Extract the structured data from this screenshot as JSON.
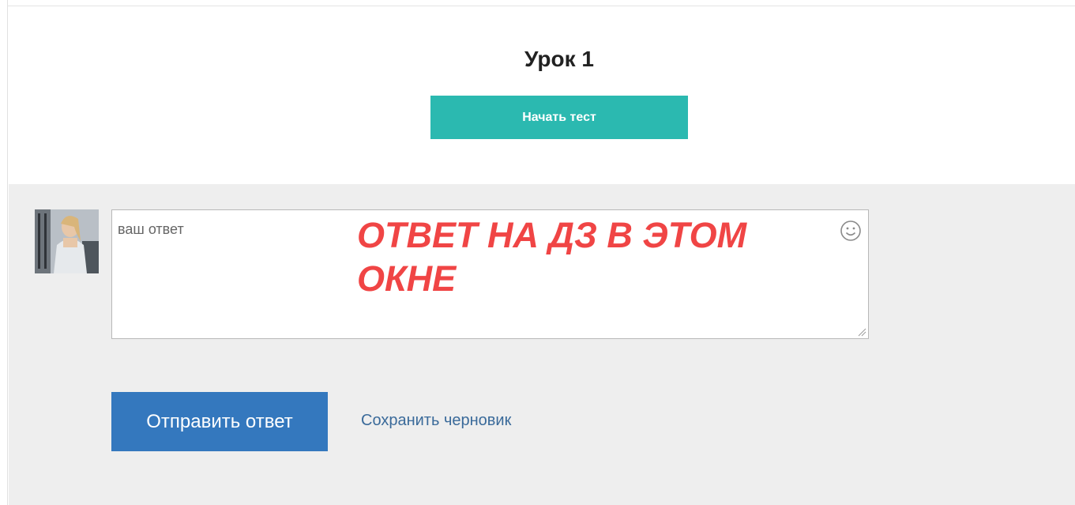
{
  "lesson": {
    "title": "Урок 1",
    "start_button_label": "Начать тест"
  },
  "comment": {
    "avatar_icon": "user-photo",
    "placeholder": "ваш ответ",
    "value": "",
    "annotation": "ОТВЕТ НА ДЗ В ЭТОМ ОКНЕ",
    "emoji_icon": "smiley-icon",
    "submit_label": "Отправить ответ",
    "save_draft_label": "Сохранить черновик"
  },
  "colors": {
    "start_button": "#2bb9b0",
    "submit_button": "#3478be",
    "annotation": "#f04545",
    "comment_background": "#eeeeee"
  }
}
